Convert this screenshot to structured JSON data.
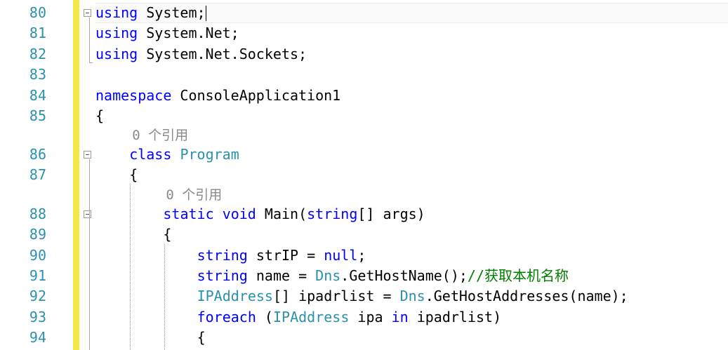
{
  "editor": {
    "lines": [
      {
        "num": "80",
        "tokens": [
          {
            "k": "kw",
            "t": "using"
          },
          {
            "k": "tx",
            "t": " System;"
          }
        ]
      },
      {
        "num": "81",
        "tokens": [
          {
            "k": "kw",
            "t": "using"
          },
          {
            "k": "tx",
            "t": " System.Net;"
          }
        ]
      },
      {
        "num": "82",
        "tokens": [
          {
            "k": "kw",
            "t": "using"
          },
          {
            "k": "tx",
            "t": " System.Net.Sockets;"
          }
        ]
      },
      {
        "num": "83",
        "tokens": []
      },
      {
        "num": "84",
        "tokens": [
          {
            "k": "kw",
            "t": "namespace"
          },
          {
            "k": "tx",
            "t": " ConsoleApplication1"
          }
        ]
      },
      {
        "num": "85",
        "tokens": [
          {
            "k": "tx",
            "t": "{"
          }
        ]
      },
      {
        "num": "86",
        "tokens": [
          {
            "k": "kw",
            "t": "class"
          },
          {
            "k": "tx",
            "t": " "
          },
          {
            "k": "ty",
            "t": "Program"
          }
        ]
      },
      {
        "num": "87",
        "tokens": [
          {
            "k": "tx",
            "t": "{"
          }
        ]
      },
      {
        "num": "88",
        "tokens": [
          {
            "k": "kw",
            "t": "static"
          },
          {
            "k": "tx",
            "t": " "
          },
          {
            "k": "kw",
            "t": "void"
          },
          {
            "k": "tx",
            "t": " Main("
          },
          {
            "k": "kw",
            "t": "string"
          },
          {
            "k": "tx",
            "t": "[] args)"
          }
        ]
      },
      {
        "num": "89",
        "tokens": [
          {
            "k": "tx",
            "t": "{"
          }
        ]
      },
      {
        "num": "90",
        "tokens": [
          {
            "k": "kw",
            "t": "string"
          },
          {
            "k": "tx",
            "t": " strIP = "
          },
          {
            "k": "kw",
            "t": "null"
          },
          {
            "k": "tx",
            "t": ";"
          }
        ]
      },
      {
        "num": "91",
        "tokens": [
          {
            "k": "kw",
            "t": "string"
          },
          {
            "k": "tx",
            "t": " name = "
          },
          {
            "k": "ty",
            "t": "Dns"
          },
          {
            "k": "tx",
            "t": ".GetHostName();"
          },
          {
            "k": "cm",
            "t": "//获取本机名称"
          }
        ]
      },
      {
        "num": "92",
        "tokens": [
          {
            "k": "ty",
            "t": "IPAddress"
          },
          {
            "k": "tx",
            "t": "[] ipadrlist = "
          },
          {
            "k": "ty",
            "t": "Dns"
          },
          {
            "k": "tx",
            "t": ".GetHostAddresses(name);"
          }
        ]
      },
      {
        "num": "93",
        "tokens": [
          {
            "k": "kw",
            "t": "foreach"
          },
          {
            "k": "tx",
            "t": " ("
          },
          {
            "k": "ty",
            "t": "IPAddress"
          },
          {
            "k": "tx",
            "t": " ipa "
          },
          {
            "k": "kw",
            "t": "in"
          },
          {
            "k": "tx",
            "t": " ipadrlist)"
          }
        ]
      },
      {
        "num": "94",
        "tokens": [
          {
            "k": "tx",
            "t": "{"
          }
        ]
      }
    ],
    "codelens": [
      {
        "label": "0 个引用"
      },
      {
        "label": "0 个引用"
      }
    ]
  }
}
